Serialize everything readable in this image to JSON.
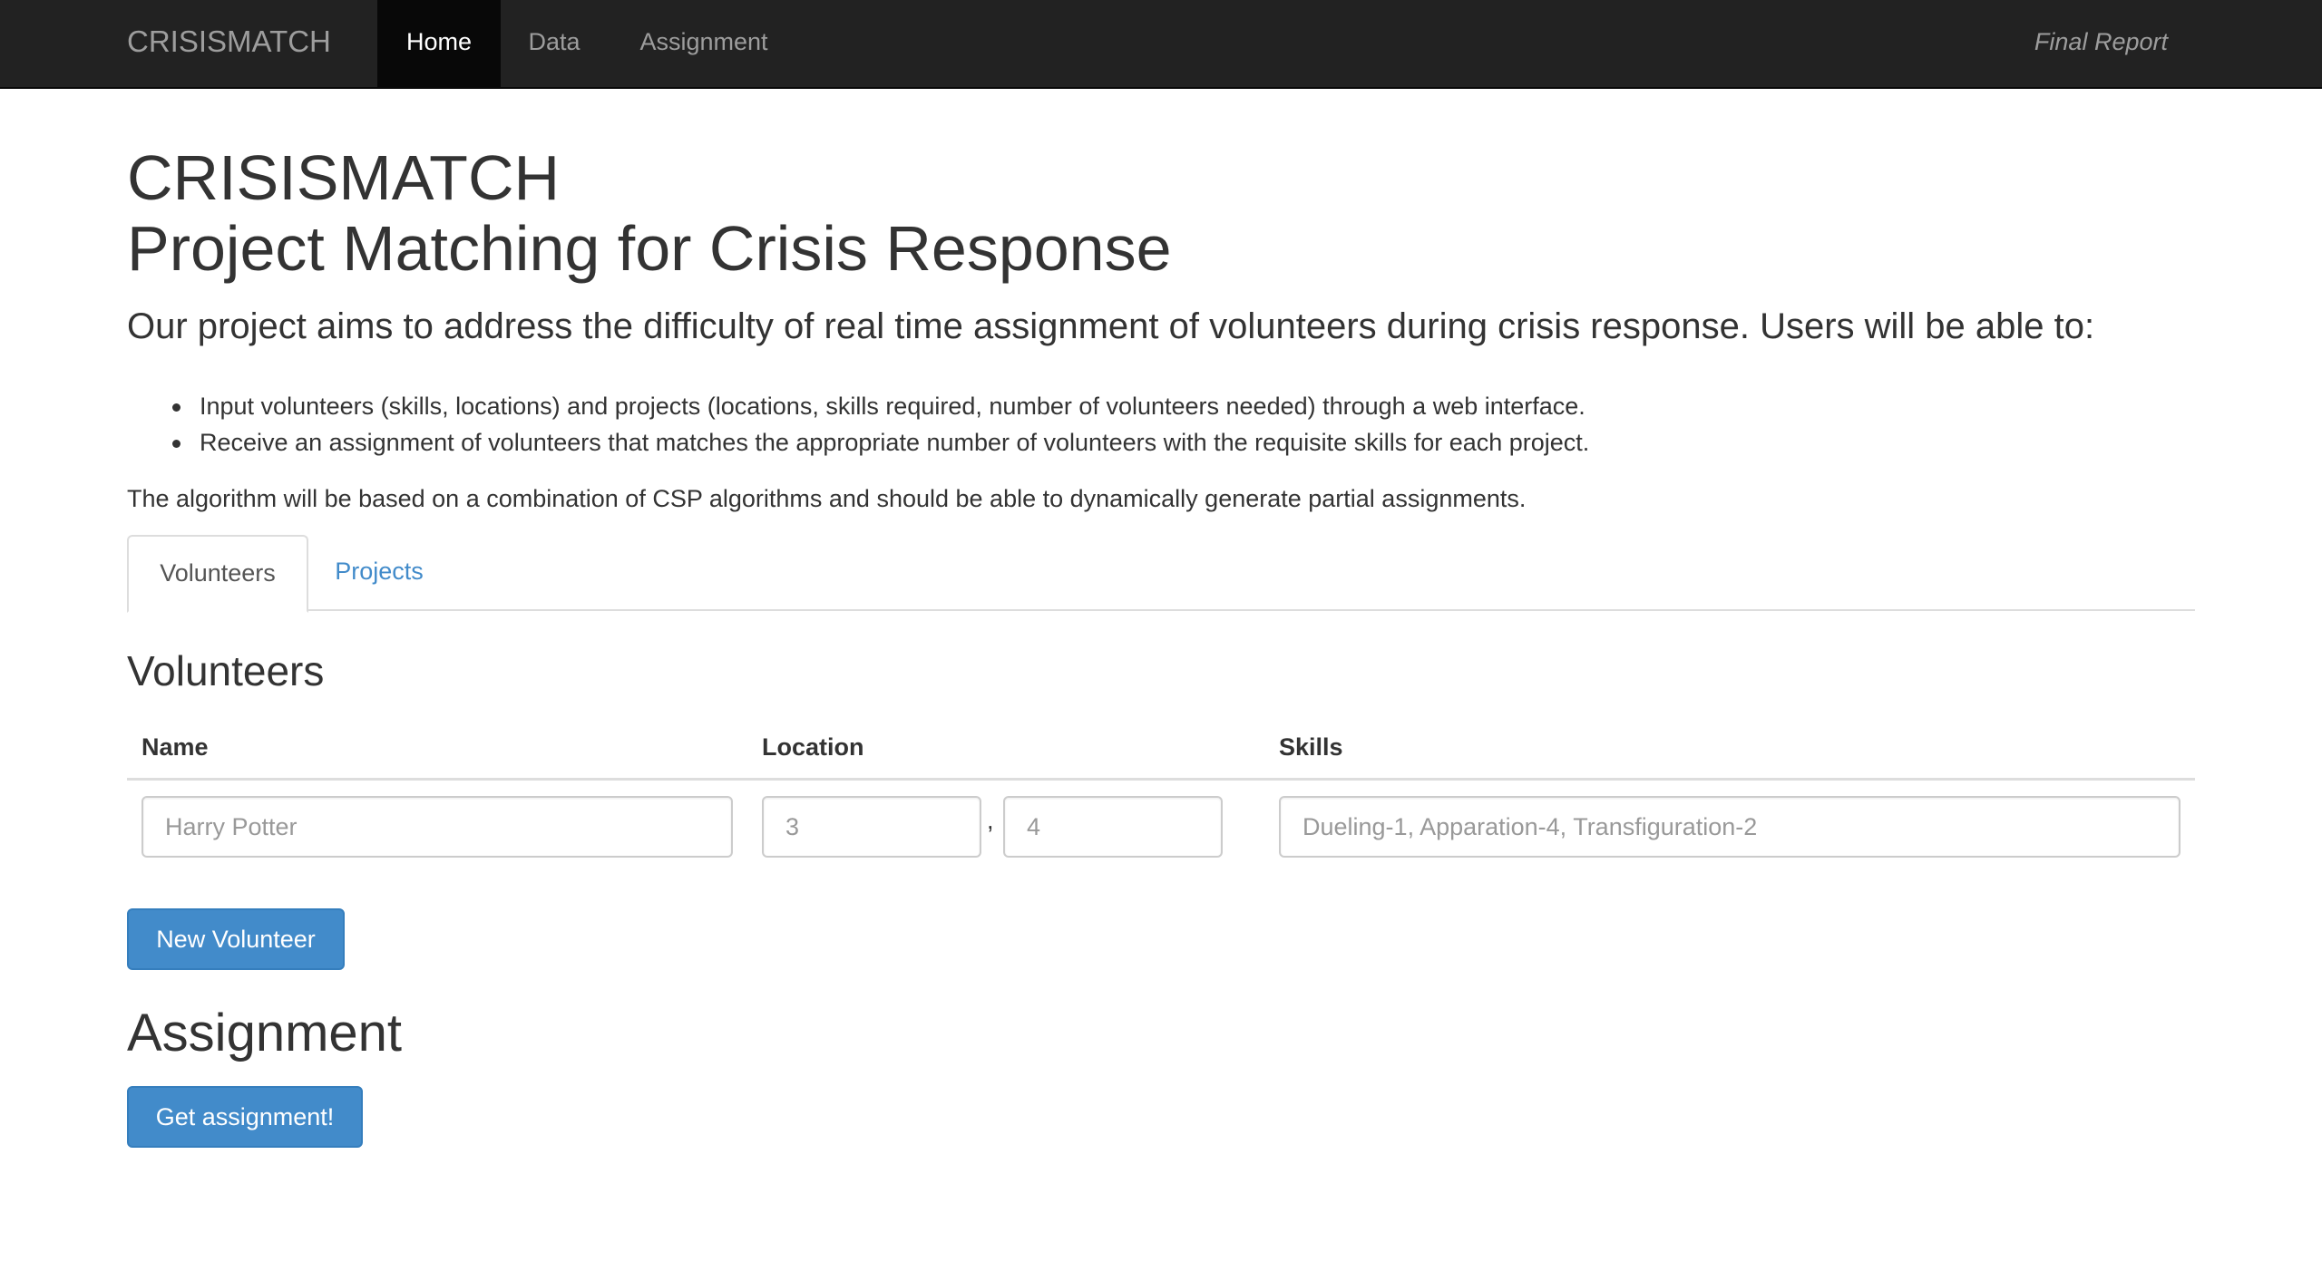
{
  "nav": {
    "brand": "CRISISMATCH",
    "items": [
      {
        "label": "Home"
      },
      {
        "label": "Data"
      },
      {
        "label": "Assignment"
      }
    ],
    "right_link": "Final Report"
  },
  "header": {
    "title_line1": "CRISISMATCH",
    "title_line2": "Project Matching for Crisis Response",
    "lead": "Our project aims to address the difficulty of real time assignment of volunteers during crisis response. Users will be able to:",
    "bullets": [
      "Input volunteers (skills, locations) and projects (locations, skills required, number of volunteers needed) through a web interface.",
      "Receive an assignment of volunteers that matches the appropriate number of volunteers with the requisite skills for each project."
    ],
    "paragraph": "The algorithm will be based on a combination of CSP algorithms and should be able to dynamically generate partial assignments."
  },
  "tabs": [
    {
      "label": "Volunteers",
      "active": true
    },
    {
      "label": "Projects",
      "active": false
    }
  ],
  "volunteers": {
    "heading": "Volunteers",
    "columns": [
      "Name",
      "Location",
      "Skills"
    ],
    "row": {
      "name_placeholder": "Harry Potter",
      "loc_x_placeholder": "3",
      "separator": ",",
      "loc_y_placeholder": "4",
      "skills_placeholder": "Dueling-1, Apparation-4, Transfiguration-2"
    },
    "new_button": "New Volunteer"
  },
  "assignment": {
    "heading": "Assignment",
    "button": "Get assignment!"
  },
  "colors": {
    "navbar_bg": "#222222",
    "primary": "#428bca",
    "link": "#428bca"
  }
}
